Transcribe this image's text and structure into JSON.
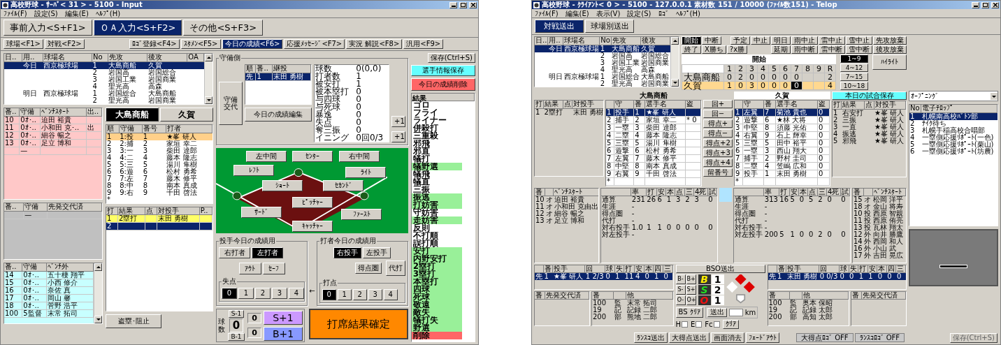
{
  "server": {
    "title": "高校野球 - ｻｰﾊﾞ< 31 > - 5100 - Input",
    "menu": [
      "ﾌｧｲﾙ(F)",
      "設定(S)",
      "編集(E)",
      "ﾍﾙﾌﾟ(H)"
    ],
    "mode_tabs": [
      {
        "label": "事前入力<S+F1>",
        "selected": false
      },
      {
        "label": "ＯＡ入力<S+F2>",
        "selected": true
      },
      {
        "label": "その他<S+F3>",
        "selected": false
      }
    ],
    "function_tab_groups": [
      [
        {
          "label": "球場<F1>",
          "selected": false
        },
        {
          "label": "対戦<F2>",
          "selected": false
        }
      ],
      [
        {
          "label": "ﾛｺﾞ登録<F4>",
          "selected": false
        },
        {
          "label": "ｽﾀﾒﾝ<F5>",
          "selected": false
        },
        {
          "label": "今日の成績<F6>",
          "selected": true
        },
        {
          "label": "応援ﾒｯｾｰｼﾞ<F7>",
          "selected": false
        },
        {
          "label": "実況 解説<F8>",
          "selected": false
        },
        {
          "label": "汎用<F9>",
          "selected": false
        }
      ]
    ],
    "games": {
      "columns": [
        "日..",
        "用..",
        "球場名",
        "No",
        "先攻",
        "後攻",
        "OA"
      ],
      "rows": [
        {
          "cells": [
            null,
            "今日",
            "西京極球場",
            "1",
            "大島商船",
            "久賀",
            null
          ],
          "selected": true
        },
        {
          "cells": [
            null,
            null,
            null,
            "2",
            "岩国高",
            "岩国総合",
            null
          ],
          "selected": false
        },
        {
          "cells": [
            null,
            null,
            null,
            "3",
            "岩国工業",
            "岩国商業",
            null
          ],
          "selected": false
        },
        {
          "cells": [
            null,
            null,
            null,
            "4",
            "聖光高",
            "高森",
            null
          ],
          "selected": false
        },
        {
          "cells": [
            null,
            "明日",
            "西京極球場",
            "1",
            "岩国総合",
            "大島商船",
            null
          ],
          "selected": false
        },
        {
          "cells": [
            null,
            null,
            null,
            "2",
            "聖光高",
            "岩国商業",
            null
          ],
          "selected": false
        }
      ]
    },
    "bench_tables": [
      {
        "kind": "start",
        "columns": [
          "番..",
          "守備",
          "ﾍﾞﾝﾁｽﾀｰﾄ",
          "出.."
        ],
        "rows": [
          [
            "10",
            "0ｵ･..",
            "迫田 裕貴",
            null
          ],
          [
            "11",
            "0ｵ･..",
            "小和田 克･..",
            "出"
          ],
          [
            "12",
            "0ｵ･..",
            "細谷 暢之",
            null
          ],
          [
            "13",
            "0ｵ･..",
            "足立 博和",
            null
          ],
          [
            null,
            "—",
            null,
            null
          ]
        ]
      },
      {
        "kind": "replaced",
        "columns": [
          "番..",
          "守備",
          "先発交代済"
        ],
        "rows": [
          [
            null,
            "—",
            null
          ]
        ]
      },
      {
        "kind": "out",
        "columns": [
          "番..",
          "守備",
          "ﾍﾞﾝﾁ外"
        ],
        "rows": [
          [
            "14",
            "0ｵ･..",
            "五十棲 翔平"
          ],
          [
            "15",
            "0ｵ･..",
            "小西 修介"
          ],
          [
            "16",
            "0ｵ･..",
            "奈佐 真"
          ],
          [
            "17",
            "0ｵ･..",
            "岡山 馨"
          ],
          [
            "18",
            "0ｵ･..",
            "菅野 浩平"
          ],
          [
            "100",
            "5監督",
            "末常 拓司"
          ]
        ]
      }
    ],
    "team_tabs": [
      {
        "label": "大島商船",
        "selected": true
      },
      {
        "label": "久賀",
        "selected": false
      }
    ],
    "lineup": {
      "columns": [
        "順",
        "守備",
        "番号",
        "打者"
      ],
      "rows": [
        {
          "cells": [
            "1",
            "1:投",
            "1",
            "★峯 研人"
          ],
          "selected": true
        },
        {
          "cells": [
            "2",
            "2:捕",
            "2",
            "家垣 幸二"
          ],
          "selected": false
        },
        {
          "cells": [
            "3",
            "3:一",
            "3",
            "柴田 達郎"
          ],
          "selected": false
        },
        {
          "cells": [
            "4",
            "4:二",
            "4",
            "藤本 隆志"
          ],
          "selected": false
        },
        {
          "cells": [
            "5",
            "5:三",
            "5",
            "湯川 隼樹"
          ],
          "selected": false
        },
        {
          "cells": [
            "6",
            "6:遊",
            "6",
            "松村 勇希"
          ],
          "selected": false
        },
        {
          "cells": [
            "7",
            "7:左",
            "7",
            "藤木 修平"
          ],
          "selected": false
        },
        {
          "cells": [
            "8",
            "8:中",
            "8",
            "南本 真成"
          ],
          "selected": false
        },
        {
          "cells": [
            "9",
            "9:右",
            "9",
            "千田 啓法"
          ],
          "selected": false
        },
        {
          "cells": [
            "*",
            null,
            null,
            null
          ],
          "selected": false
        }
      ]
    },
    "at_bats": {
      "columns": [
        "打",
        "結果",
        "点",
        "対投手",
        "P.."
      ],
      "rows": [
        {
          "cells": [
            "1",
            "2塁打",
            null,
            "末田 勇樹",
            null
          ],
          "highlighted": true,
          "selected": false
        },
        {
          "cells": [
            "2",
            null,
            null,
            null,
            null
          ],
          "selected": true
        }
      ]
    },
    "steal_button": "盗塁･阻止",
    "defense": {
      "legend": "守備側",
      "change_button": "守備交代",
      "pitchers": {
        "columns": [
          "順",
          "番..",
          "継投"
        ],
        "rows": [
          {
            "cells": [
              "先",
              "1",
              "末田 勇樹"
            ],
            "selected": true
          }
        ]
      },
      "edit_button": "今日の成績編集",
      "stats": [
        [
          "球数",
          "0(0,0)"
        ],
        [
          "打者数",
          "1"
        ],
        [
          "被安打",
          "1"
        ],
        [
          "被本塁打",
          "0"
        ],
        [
          "与四球",
          "0"
        ],
        [
          "与死球",
          "0"
        ],
        [
          "暴逸",
          "0"
        ],
        [
          "失点",
          "0"
        ],
        [
          "奪三振",
          "0"
        ],
        [
          "イニング",
          "0回0/3"
        ]
      ],
      "plus_buttons": [
        "+1",
        "+1"
      ]
    },
    "field_buttons": [
      "左中間",
      "ｾﾝﾀｰ",
      "右中間",
      "ﾚﾌﾄ",
      "ﾗｲﾄ",
      "ｼｮｰﾄ",
      "ｾｶﾝﾄﾞ",
      "ﾋﾟｯﾁｬｰ",
      "ｻｰﾄﾞ",
      "ﾌｧｰｽﾄ",
      "ｷｬｯﾁｬｰ"
    ],
    "pitcher_panel": {
      "legend": "投手今日の成績用",
      "hands": [
        {
          "label": "右打者",
          "selected": false
        },
        {
          "label": "左打者",
          "selected": true
        }
      ],
      "judgements": [
        "ｱｳﾄ",
        "ｾｰﾌ"
      ],
      "runs": {
        "legend": "失点",
        "options": [
          {
            "label": "0",
            "selected": true
          },
          {
            "label": "1",
            "selected": false
          },
          {
            "label": "2",
            "selected": false
          },
          {
            "label": "3",
            "selected": false
          },
          {
            "label": "4",
            "selected": false
          }
        ]
      }
    },
    "arrow": "←",
    "batter_panel": {
      "legend": "打者今日の成績用",
      "hands": [
        {
          "label": "右投手",
          "selected": true
        },
        {
          "label": "左投手",
          "selected": false
        }
      ],
      "scoring_button": "得点圏",
      "pinch_button": "代打",
      "rbi": {
        "legend": "打点",
        "options": [
          {
            "label": "0",
            "selected": true
          },
          {
            "label": "1",
            "selected": false
          },
          {
            "label": "2",
            "selected": false
          },
          {
            "label": "3",
            "selected": false
          },
          {
            "label": "4",
            "selected": false
          }
        ]
      }
    },
    "count": {
      "label": "球数",
      "strike_minus": "S-1",
      "total": "0",
      "ball_minus": "B-1",
      "strikes": "0",
      "balls": "0",
      "strike_plus": "S+1",
      "ball_plus": "B+1"
    },
    "confirm_button": "打席結果確定",
    "save_button": "保存(Ctrl+S)",
    "player_save_button": "選手情報保存",
    "delete_button": "今日の成績削除",
    "results": {
      "header": "結果",
      "items": [
        {
          "label": "ゴロ",
          "color": "#ffffff"
        },
        {
          "label": "フライ",
          "color": "#ffffff"
        },
        {
          "label": "ライナー",
          "color": "#ffffff"
        },
        {
          "label": "併殺打",
          "color": "#ffffff"
        },
        {
          "label": "三重殺",
          "color": "#ffffff"
        },
        {
          "label": "邪飛",
          "color": "#ffffff"
        },
        {
          "label": "邪直",
          "color": "#ffffff"
        },
        {
          "label": "犠打",
          "color": "#ffffff"
        },
        {
          "label": "犠野選",
          "color": "#99f099"
        },
        {
          "label": "犠飛",
          "color": "#ffffff"
        },
        {
          "label": "犠直",
          "color": "#ffffff"
        },
        {
          "label": "三振",
          "color": "#ffffff"
        },
        {
          "label": "振逃",
          "color": "#99f099"
        },
        {
          "label": "打妨害",
          "color": "#99f099"
        },
        {
          "label": "守妨害",
          "color": "#ffffff"
        },
        {
          "label": "走妨害",
          "color": "#99f099"
        },
        {
          "label": "反則",
          "color": "#ffffff"
        },
        {
          "label": "不打順",
          "color": "#ffffff"
        },
        {
          "label": "誤打順",
          "color": "#ffffff"
        },
        {
          "label": "安打",
          "color": "#99f099"
        },
        {
          "label": "内野安打",
          "color": "#99f099"
        },
        {
          "label": "2塁打",
          "color": "#99f099"
        },
        {
          "label": "3塁打",
          "color": "#99f099"
        },
        {
          "label": "本塁打",
          "color": "#99f099"
        },
        {
          "label": "四球",
          "color": "#99f099"
        },
        {
          "label": "死球",
          "color": "#99f099"
        },
        {
          "label": "敬遠",
          "color": "#99f099"
        },
        {
          "label": "敵失",
          "color": "#99f099"
        },
        {
          "label": "犠打失",
          "color": "#99f099"
        },
        {
          "label": "野選",
          "color": "#99f099"
        },
        {
          "label": "削除",
          "color": "#ff6666"
        }
      ]
    }
  },
  "client": {
    "title": "高校野球 - ｸﾗｲｱﾝﾄ< 0 > - 5100 - 127.0.0.1  素材数 151 / 10000 (ﾌｧｲﾙ数151) - Telop",
    "menu": [
      "ﾌｧｲﾙ(F)",
      "編集(E)",
      "表示(V)",
      "設定(S)",
      "ﾛｺﾞ",
      "ﾍﾙﾌﾟ(H)"
    ],
    "mode_tabs": [
      {
        "label": "対戦送出",
        "selected": true
      },
      {
        "label": "球場別送出",
        "selected": false
      }
    ],
    "games": {
      "columns": [
        "日..",
        "用..",
        "球場名",
        "No",
        "先攻",
        "後攻"
      ],
      "rows": [
        {
          "cells": [
            null,
            "今日",
            "西京極球場",
            "1",
            "大島商船",
            "久賀"
          ],
          "selected": true
        },
        {
          "cells": [
            null,
            null,
            null,
            "2",
            "岩国高",
            "岩国総合"
          ],
          "selected": false
        },
        {
          "cells": [
            null,
            null,
            null,
            "3",
            "岩国工業",
            "岩国商業"
          ],
          "selected": false
        },
        {
          "cells": [
            null,
            null,
            null,
            "4",
            "聖光高",
            "高森"
          ],
          "selected": false
        },
        {
          "cells": [
            null,
            "明日",
            "西京極球場",
            "1",
            "岩国総合",
            "大島商船"
          ],
          "selected": false
        },
        {
          "cells": [
            null,
            null,
            null,
            "2",
            "聖光高",
            "岩国商業"
          ],
          "selected": false
        }
      ]
    },
    "game_controls": {
      "left": [
        [
          {
            "label": "開始",
            "selected": true
          },
          {
            "label": "中断",
            "selected": false
          }
        ],
        [
          {
            "label": "終了",
            "selected": false
          },
          {
            "label": "X勝ち",
            "selected": false
          },
          {
            "label": "?x勝",
            "selected": false
          }
        ]
      ],
      "right": [
        [
          {
            "label": "予定",
            "selected": false
          },
          {
            "label": "中止",
            "selected": false
          },
          {
            "label": "明日",
            "selected": false
          },
          {
            "label": "雨中止",
            "selected": false
          },
          {
            "label": "雷中止",
            "selected": false
          },
          {
            "label": "雪中止",
            "selected": false
          },
          {
            "label": "先攻放棄",
            "selected": false
          }
        ],
        [
          {
            "label": "延期",
            "selected": false
          },
          {
            "label": "雨中断",
            "selected": false
          },
          {
            "label": "雷中断",
            "selected": false
          },
          {
            "label": "雪中断",
            "selected": false
          },
          {
            "label": "後攻放棄",
            "selected": false
          }
        ]
      ]
    },
    "scoreboard": {
      "status": "開始",
      "innings": [
        "1",
        "2",
        "3",
        "4",
        "5",
        "6",
        "7",
        "8",
        "9",
        "R"
      ],
      "rows": [
        {
          "team": "大島商船",
          "runs": [
            "0",
            "2",
            "0",
            "0",
            "0",
            "0",
            "0"
          ],
          "total": "2",
          "batting": false
        },
        {
          "team": "久賀",
          "runs": [
            "1",
            "0",
            "3",
            "0",
            "0",
            "0",
            "0"
          ],
          "total": "4",
          "batting": true
        }
      ]
    },
    "inning_ranges": [
      {
        "label": "1~9",
        "selected": true
      },
      {
        "label": "4~12",
        "selected": false
      },
      {
        "label": "7~15",
        "selected": false
      },
      {
        "label": "10~18",
        "selected": false
      }
    ],
    "highlight_button": "ﾊｲﾗｲﾄ",
    "game_save_button": "本日の試合保存",
    "teams": [
      "大島商船",
      "久賀"
    ],
    "at_bats_left": {
      "columns": [
        "打",
        "結果",
        "点",
        "対投手"
      ],
      "rows": [
        [
          "1",
          "2塁打",
          null,
          "末田 勇樹"
        ]
      ]
    },
    "lineups": [
      {
        "columns": [
          null,
          "守",
          "番",
          "選手名",
          "盗"
        ],
        "rows": [
          {
            "cells": [
              "1",
              "投手",
              "1",
              "★峯 研人",
              null
            ],
            "selected": true
          },
          {
            "cells": [
              "2",
              "捕手",
              "2",
              "家垣 幸二",
              "* 0"
            ],
            "selected": false
          },
          {
            "cells": [
              "3",
              "一塁",
              "3",
              "柴田 達郎",
              null
            ],
            "selected": false
          },
          {
            "cells": [
              "4",
              "二塁",
              "4",
              "藤本 隆志",
              null
            ],
            "selected": false
          },
          {
            "cells": [
              "5",
              "三塁",
              "5",
              "湯川 隼樹",
              null
            ],
            "selected": false
          },
          {
            "cells": [
              "6",
              "遊撃",
              "6",
              "松村 勇希",
              null
            ],
            "selected": false
          },
          {
            "cells": [
              "7",
              "左翼",
              "7",
              "藤木 修平",
              null
            ],
            "selected": false
          },
          {
            "cells": [
              "8",
              "中堅",
              "8",
              "南本 真成",
              null
            ],
            "selected": false
          },
          {
            "cells": [
              "9",
              "右翼",
              "9",
              "千田 啓法",
              null
            ],
            "selected": false
          },
          {
            "cells": [
              "*",
              null,
              null,
              null,
              null
            ],
            "selected": false
          }
        ]
      },
      {
        "columns": [
          null,
          "守",
          "番",
          "選手名",
          "盗"
        ],
        "rows": [
          {
            "cells": [
              "1",
              "左翼",
              "7",
              "菊池 貴也",
              "0"
            ],
            "selected": true
          },
          {
            "cells": [
              "2",
              "遊撃",
              "6",
              "★林 大将",
              "0"
            ],
            "selected": false
          },
          {
            "cells": [
              "3",
              "中堅",
              "8",
              "須藤 光佑",
              "0"
            ],
            "selected": false
          },
          {
            "cells": [
              "4",
              "右翼",
              "9",
              "石上 輝幸",
              "0"
            ],
            "selected": false
          },
          {
            "cells": [
              "5",
              "三塁",
              "5",
              "田中 裕平",
              "0"
            ],
            "selected": false
          },
          {
            "cells": [
              "6",
              "一塁",
              "3",
              "西山 翔大",
              "0"
            ],
            "selected": false
          },
          {
            "cells": [
              "7",
              "捕手",
              "2",
              "野村 圭司",
              "0"
            ],
            "selected": false
          },
          {
            "cells": [
              "8",
              "二塁",
              "4",
              "笠嶋 広和",
              "0"
            ],
            "selected": false
          },
          {
            "cells": [
              "9",
              "投手",
              "1",
              "末田 勇樹",
              "0"
            ],
            "selected": false
          },
          {
            "cells": [
              "*",
              null,
              null,
              null,
              null
            ],
            "selected": false
          }
        ]
      }
    ],
    "score_buttons": [
      "回+",
      "回−",
      "得点+",
      "得点−",
      "得点+2",
      "得点+3",
      "得点+4",
      "留番号"
    ],
    "at_bats_right": {
      "columns": [
        "打",
        "結果",
        "点",
        "対投手"
      ],
      "rows": [
        [
          "1",
          "右安打",
          null,
          "★峯 研人"
        ],
        [
          "2",
          "三振",
          null,
          "★峯 研人"
        ],
        [
          "3",
          "一直",
          null,
          "★峯 研人"
        ],
        [
          "4",
          "振逃",
          null,
          "★峯 研人"
        ],
        [
          "5",
          "邪飛",
          null,
          "★峯 研人"
        ]
      ]
    },
    "benches": [
      {
        "columns": [
          "番",
          null,
          "ﾍﾞﾝﾁｽﾀｰﾄ"
        ],
        "rows": [
          [
            "10",
            "オ",
            "迫田 裕貴"
          ],
          [
            "11",
            "オ",
            "小和田 克由出"
          ],
          [
            "12",
            "オ",
            "細谷 暢之"
          ],
          [
            "13",
            "オ",
            "足立 博和"
          ]
        ]
      },
      {
        "columns": [
          "番",
          null,
          "ﾍﾞﾝﾁｽﾀｰﾄ"
        ],
        "rows": [
          [
            "15",
            "オ",
            "松岡 洋平"
          ],
          [
            "18",
            "オ",
            "金山 将寿"
          ],
          [
            "10",
            "投",
            "西原 智親"
          ],
          [
            "11",
            "投",
            "西原 侑亮"
          ],
          [
            "13",
            "投",
            "瓦林 翔太"
          ],
          [
            "12",
            "外",
            "向井 勝鷹"
          ],
          [
            "14",
            "外",
            "西岡 和人"
          ],
          [
            "16",
            "外",
            "小山 武"
          ],
          [
            "17",
            "外",
            "吉田 晃広"
          ]
        ]
      }
    ],
    "batting_stats": [
      {
        "columns": [
          null,
          "率",
          "打",
          "安",
          "本",
          "点",
          "三",
          "4死",
          "試"
        ],
        "rows": [
          [
            "通算",
            "231",
            "26",
            "6",
            "1",
            "3",
            "2",
            "3",
            "0"
          ],
          [
            "生涯",
            "-"
          ],
          [
            "得点圏",
            "-"
          ],
          [
            "代打",
            "-"
          ],
          [
            "対右投手",
            "1.0",
            "1",
            "1",
            "0",
            "0",
            "0",
            "0",
            "0"
          ],
          [
            "対左投手",
            "-"
          ]
        ]
      },
      {
        "columns": [
          null,
          "率",
          "打",
          "安",
          "本",
          "点",
          "三",
          "4死",
          "試"
        ],
        "rows": [
          [
            "通算",
            "313",
            "16",
            "5",
            "0",
            "5",
            "2",
            "0",
            "0"
          ],
          [
            "生涯",
            "-"
          ],
          [
            "得点圏",
            "-"
          ],
          [
            "代打",
            "-"
          ],
          [
            "対右投手",
            "-"
          ],
          [
            "対左投手",
            "200",
            "5",
            "1",
            "0",
            "0",
            "2",
            "0",
            "0"
          ]
        ]
      }
    ],
    "pitching": [
      {
        "columns": [
          null,
          "番",
          "投手",
          "回",
          "球",
          "失",
          "打",
          "安",
          "本",
          "四",
          "三"
        ],
        "rows": [
          {
            "cells": [
              "先",
              "1",
              "★峯 研人",
              "1 2/3",
              "0",
              "1",
              "11",
              "4",
              "0",
              "1",
              "0"
            ],
            "selected": true
          }
        ]
      },
      {
        "columns": [
          null,
          "番",
          "投手",
          "回",
          "球",
          "失",
          "打",
          "安",
          "本",
          "四",
          "三"
        ],
        "rows": [
          {
            "cells": [
              "先",
              "1",
              "末田 勇樹",
              "0 0/3",
              "0",
              "0",
              "1",
              "1",
              "0",
              "0",
              "0"
            ],
            "selected": true
          }
        ]
      }
    ],
    "bso_button": "BSO送出",
    "count": [
      {
        "kind": "ball",
        "letter": "B",
        "value": "1",
        "minus": "B-",
        "plus": "B+"
      },
      {
        "kind": "strike",
        "letter": "S",
        "value": "2",
        "minus": "S-",
        "plus": "S+"
      },
      {
        "kind": "out",
        "letter": "O",
        "value": "1",
        "minus": "O-",
        "plus": "O+"
      }
    ],
    "bs_clear_button": "BS ｸﾘｱ",
    "bases": {
      "first": true,
      "second": true,
      "third": false
    },
    "send_button": "送出",
    "speed_unit": "km",
    "flags": [
      {
        "label": "H",
        "checked": false
      },
      {
        "label": "E",
        "checked": false
      },
      {
        "label": "Fc",
        "checked": false
      }
    ],
    "clear_button": "ｸﾘｱ",
    "replaced_tables": [
      {
        "columns": [
          "番",
          "先発交代済"
        ]
      },
      {
        "columns": [
          "番",
          "先発交代済"
        ]
      }
    ],
    "staff_tables": [
      {
        "columns": [
          "番",
          null,
          "他"
        ],
        "rows": [
          [
            "100",
            "監",
            "末常 拓司"
          ],
          [
            "19",
            "記",
            "記録 二郎"
          ],
          [
            "200",
            "部",
            "熊地 二郎"
          ]
        ]
      },
      {
        "columns": [
          "番",
          null,
          "他"
        ],
        "rows": [
          [
            "100",
            "監",
            "奥本 保昭"
          ],
          [
            "19",
            "記",
            "記録 太郎"
          ],
          [
            "200",
            "部",
            "高知 太郎"
          ]
        ]
      }
    ],
    "send_buttons": [
      "ﾗﾝｽｺ送出",
      "大得点送出",
      "画面消去",
      "ﾌｪｰﾄﾞｱｳﾄ"
    ],
    "logo_toggles": [
      "大得点ﾛｺﾞ OFF",
      "ﾗﾝｽｺﾛｺﾞ OFF"
    ],
    "save_button": "保存(Ctrl+S)",
    "telop_select": "ｵｰﾌﾟﾆﾝｸﾞ",
    "telops": {
      "columns": [
        "No",
        "電子ﾃﾛｯﾌﾟ"
      ],
      "rows": [
        {
          "cells": [
            "1",
            "札幌南高校ﾊﾞﾄﾝ部"
          ],
          "selected": true
        },
        {
          "cells": [
            "2",
            "ﾃｲｸ待ち"
          ],
          "selected": false
        },
        {
          "cells": [
            "3",
            "札幌手稲高校合唱部"
          ],
          "selected": false
        },
        {
          "cells": [
            "4",
            "一塁側応援ﾘﾎﾟｰﾄ(一色)"
          ],
          "selected": false
        },
        {
          "cells": [
            "5",
            "一塁側応援ﾘﾎﾟｰﾄ(栗山)"
          ],
          "selected": false
        },
        {
          "cells": [
            "6",
            "一塁側応援ﾘﾎﾟｰﾄ(坊農)"
          ],
          "selected": false
        }
      ]
    }
  }
}
